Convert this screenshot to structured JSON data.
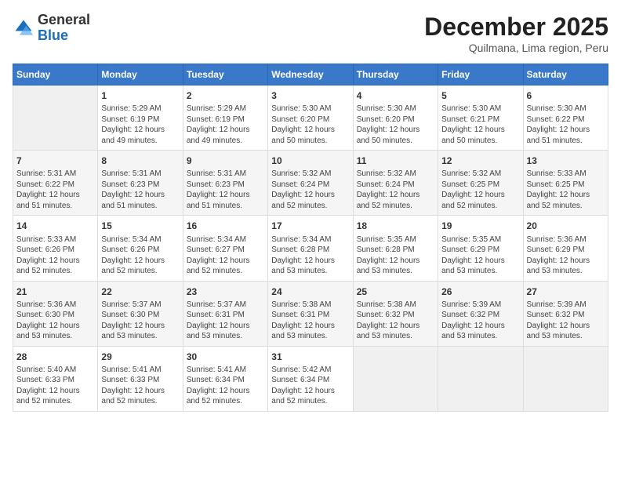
{
  "logo": {
    "general": "General",
    "blue": "Blue"
  },
  "title": "December 2025",
  "subtitle": "Quilmana, Lima region, Peru",
  "header_row": [
    "Sunday",
    "Monday",
    "Tuesday",
    "Wednesday",
    "Thursday",
    "Friday",
    "Saturday"
  ],
  "weeks": [
    [
      {
        "num": "",
        "info": "",
        "empty": true
      },
      {
        "num": "1",
        "info": "Sunrise: 5:29 AM\nSunset: 6:19 PM\nDaylight: 12 hours\nand 49 minutes."
      },
      {
        "num": "2",
        "info": "Sunrise: 5:29 AM\nSunset: 6:19 PM\nDaylight: 12 hours\nand 49 minutes."
      },
      {
        "num": "3",
        "info": "Sunrise: 5:30 AM\nSunset: 6:20 PM\nDaylight: 12 hours\nand 50 minutes."
      },
      {
        "num": "4",
        "info": "Sunrise: 5:30 AM\nSunset: 6:20 PM\nDaylight: 12 hours\nand 50 minutes."
      },
      {
        "num": "5",
        "info": "Sunrise: 5:30 AM\nSunset: 6:21 PM\nDaylight: 12 hours\nand 50 minutes."
      },
      {
        "num": "6",
        "info": "Sunrise: 5:30 AM\nSunset: 6:22 PM\nDaylight: 12 hours\nand 51 minutes."
      }
    ],
    [
      {
        "num": "7",
        "info": "Sunrise: 5:31 AM\nSunset: 6:22 PM\nDaylight: 12 hours\nand 51 minutes."
      },
      {
        "num": "8",
        "info": "Sunrise: 5:31 AM\nSunset: 6:23 PM\nDaylight: 12 hours\nand 51 minutes."
      },
      {
        "num": "9",
        "info": "Sunrise: 5:31 AM\nSunset: 6:23 PM\nDaylight: 12 hours\nand 51 minutes."
      },
      {
        "num": "10",
        "info": "Sunrise: 5:32 AM\nSunset: 6:24 PM\nDaylight: 12 hours\nand 52 minutes."
      },
      {
        "num": "11",
        "info": "Sunrise: 5:32 AM\nSunset: 6:24 PM\nDaylight: 12 hours\nand 52 minutes."
      },
      {
        "num": "12",
        "info": "Sunrise: 5:32 AM\nSunset: 6:25 PM\nDaylight: 12 hours\nand 52 minutes."
      },
      {
        "num": "13",
        "info": "Sunrise: 5:33 AM\nSunset: 6:25 PM\nDaylight: 12 hours\nand 52 minutes."
      }
    ],
    [
      {
        "num": "14",
        "info": "Sunrise: 5:33 AM\nSunset: 6:26 PM\nDaylight: 12 hours\nand 52 minutes."
      },
      {
        "num": "15",
        "info": "Sunrise: 5:34 AM\nSunset: 6:26 PM\nDaylight: 12 hours\nand 52 minutes."
      },
      {
        "num": "16",
        "info": "Sunrise: 5:34 AM\nSunset: 6:27 PM\nDaylight: 12 hours\nand 52 minutes."
      },
      {
        "num": "17",
        "info": "Sunrise: 5:34 AM\nSunset: 6:28 PM\nDaylight: 12 hours\nand 53 minutes."
      },
      {
        "num": "18",
        "info": "Sunrise: 5:35 AM\nSunset: 6:28 PM\nDaylight: 12 hours\nand 53 minutes."
      },
      {
        "num": "19",
        "info": "Sunrise: 5:35 AM\nSunset: 6:29 PM\nDaylight: 12 hours\nand 53 minutes."
      },
      {
        "num": "20",
        "info": "Sunrise: 5:36 AM\nSunset: 6:29 PM\nDaylight: 12 hours\nand 53 minutes."
      }
    ],
    [
      {
        "num": "21",
        "info": "Sunrise: 5:36 AM\nSunset: 6:30 PM\nDaylight: 12 hours\nand 53 minutes."
      },
      {
        "num": "22",
        "info": "Sunrise: 5:37 AM\nSunset: 6:30 PM\nDaylight: 12 hours\nand 53 minutes."
      },
      {
        "num": "23",
        "info": "Sunrise: 5:37 AM\nSunset: 6:31 PM\nDaylight: 12 hours\nand 53 minutes."
      },
      {
        "num": "24",
        "info": "Sunrise: 5:38 AM\nSunset: 6:31 PM\nDaylight: 12 hours\nand 53 minutes."
      },
      {
        "num": "25",
        "info": "Sunrise: 5:38 AM\nSunset: 6:32 PM\nDaylight: 12 hours\nand 53 minutes."
      },
      {
        "num": "26",
        "info": "Sunrise: 5:39 AM\nSunset: 6:32 PM\nDaylight: 12 hours\nand 53 minutes."
      },
      {
        "num": "27",
        "info": "Sunrise: 5:39 AM\nSunset: 6:32 PM\nDaylight: 12 hours\nand 53 minutes."
      }
    ],
    [
      {
        "num": "28",
        "info": "Sunrise: 5:40 AM\nSunset: 6:33 PM\nDaylight: 12 hours\nand 52 minutes."
      },
      {
        "num": "29",
        "info": "Sunrise: 5:41 AM\nSunset: 6:33 PM\nDaylight: 12 hours\nand 52 minutes."
      },
      {
        "num": "30",
        "info": "Sunrise: 5:41 AM\nSunset: 6:34 PM\nDaylight: 12 hours\nand 52 minutes."
      },
      {
        "num": "31",
        "info": "Sunrise: 5:42 AM\nSunset: 6:34 PM\nDaylight: 12 hours\nand 52 minutes."
      },
      {
        "num": "",
        "info": "",
        "empty": true
      },
      {
        "num": "",
        "info": "",
        "empty": true
      },
      {
        "num": "",
        "info": "",
        "empty": true
      }
    ]
  ]
}
